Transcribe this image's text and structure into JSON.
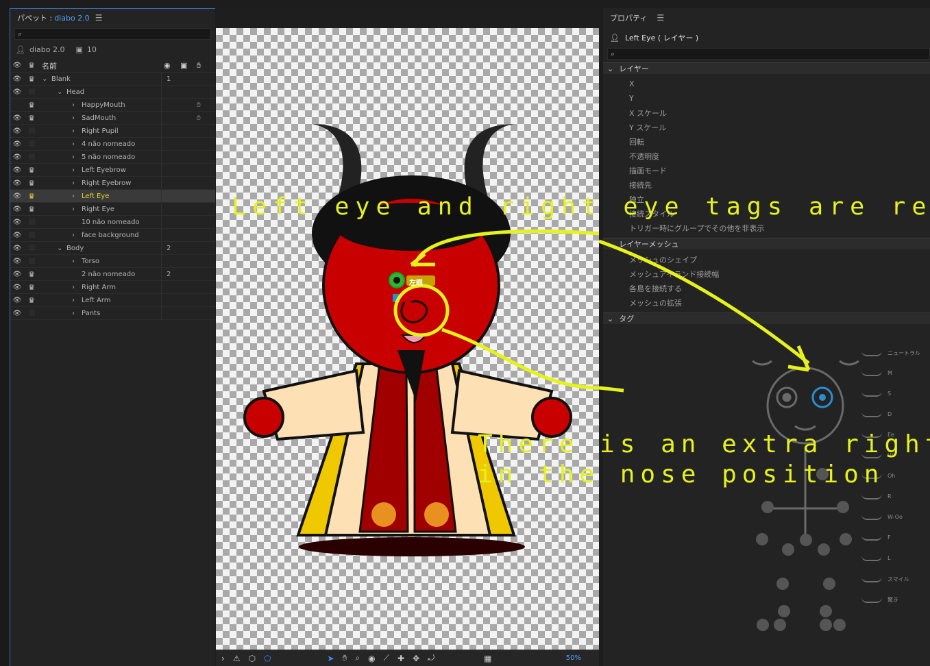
{
  "puppet_panel": {
    "title": "パペット :",
    "puppet_name": "diabo 2.0",
    "menu_icon": "hamburger-icon",
    "search_placeholder": "",
    "puppet_label": "diabo 2.0",
    "count": "10",
    "header": {
      "name_col": "名前"
    },
    "rows": [
      {
        "label": "Blank",
        "indent": 0,
        "eye": true,
        "crown": true,
        "num": "1",
        "expanded": true
      },
      {
        "label": "Head",
        "indent": 1,
        "eye": true,
        "crown": false,
        "num": "",
        "expanded": true
      },
      {
        "label": "HappyMouth",
        "indent": 2,
        "eye": false,
        "crown": true,
        "num": "",
        "hand": true
      },
      {
        "label": "SadMouth",
        "indent": 2,
        "eye": true,
        "crown": true,
        "num": "",
        "hand": true
      },
      {
        "label": "Right Pupil",
        "indent": 2,
        "eye": true,
        "crown": false,
        "num": ""
      },
      {
        "label": "4 não nomeado",
        "indent": 2,
        "eye": true,
        "crown": false,
        "num": ""
      },
      {
        "label": "5 não nomeado",
        "indent": 2,
        "eye": true,
        "crown": false,
        "num": ""
      },
      {
        "label": "Left Eyebrow",
        "indent": 2,
        "eye": true,
        "crown": true,
        "num": ""
      },
      {
        "label": "Right Eyebrow",
        "indent": 2,
        "eye": true,
        "crown": true,
        "num": ""
      },
      {
        "label": "Left Eye",
        "indent": 2,
        "eye": true,
        "crown": true,
        "num": "",
        "selected": true
      },
      {
        "label": "Right Eye",
        "indent": 2,
        "eye": true,
        "crown": true,
        "num": ""
      },
      {
        "label": "10 não nomeado",
        "indent": 2,
        "eye": true,
        "crown": false,
        "num": "",
        "nochev": true
      },
      {
        "label": "face background",
        "indent": 2,
        "eye": true,
        "crown": false,
        "num": ""
      },
      {
        "label": "Body",
        "indent": 1,
        "eye": true,
        "crown": false,
        "num": "2",
        "expanded": true
      },
      {
        "label": "Torso",
        "indent": 2,
        "eye": true,
        "crown": false,
        "num": ""
      },
      {
        "label": "2 não nomeado",
        "indent": 2,
        "eye": true,
        "crown": true,
        "num": "2",
        "nochev": true
      },
      {
        "label": "Right Arm",
        "indent": 2,
        "eye": true,
        "crown": true,
        "num": ""
      },
      {
        "label": "Left Arm",
        "indent": 2,
        "eye": true,
        "crown": true,
        "num": ""
      },
      {
        "label": "Pants",
        "indent": 2,
        "eye": true,
        "crown": false,
        "num": ""
      }
    ]
  },
  "canvas": {
    "tag_label": "左眼",
    "zoom": "50%"
  },
  "properties_panel": {
    "title": "プロパティ",
    "layer_title": "Left Eye ( レイヤー )",
    "sections": {
      "layer": "レイヤー",
      "layer_mesh": "レイヤーメッシュ",
      "tags": "タグ"
    },
    "layer_props": [
      "X",
      "Y",
      "X スケール",
      "Y スケール",
      "回転",
      "不透明度",
      "描画モード",
      "接続先",
      "独立",
      "接続スタイル",
      "トリガー時にグループでその他を非表示"
    ],
    "mesh_props": [
      "メッシュのシェイプ",
      "メッシュアイランド接続幅",
      "各島を接続する",
      "メッシュの拡張"
    ],
    "mouth_tags": [
      "ニュートラル",
      "M",
      "S",
      "D",
      "Ee",
      "Uh",
      "Oh",
      "R",
      "W-Oo",
      "F",
      "L",
      "スマイル",
      "驚き"
    ]
  },
  "annotations": {
    "line1": "Left eye and right eye tags are reversed",
    "line2": "There is an extra right eye",
    "line3": "in the nose position"
  },
  "colors": {
    "accent": "#4ea1ff",
    "annotation": "#e5f21c",
    "selected_label": "#e8d236",
    "devil_red": "#c80000",
    "eye_tag_blue": "#2a8fd0"
  }
}
